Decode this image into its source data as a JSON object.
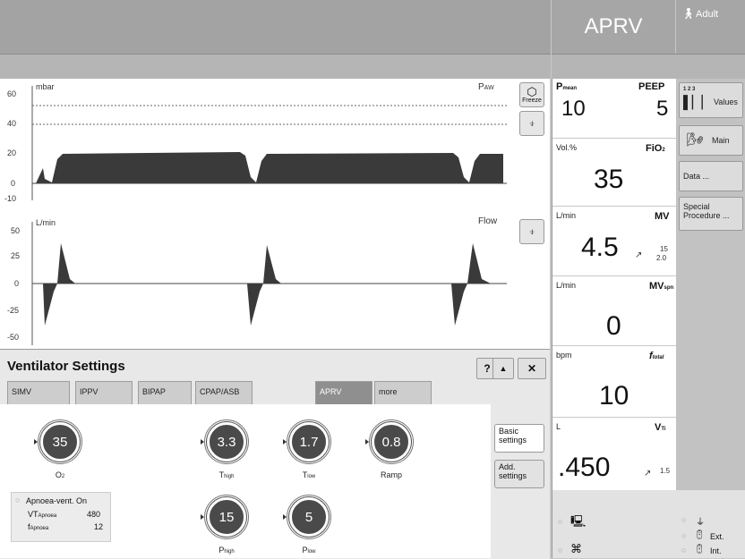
{
  "header": {
    "mode": "APRV",
    "patient_type": "Adult"
  },
  "graph": {
    "paw": {
      "unit": "mbar",
      "name": "Pₐw",
      "name_main": "P",
      "name_sub": "AW",
      "ticks": [
        "60",
        "40",
        "20",
        "0",
        "-10"
      ]
    },
    "flow": {
      "unit": "L/min",
      "name": "Flow",
      "ticks": [
        "50",
        "25",
        "0",
        "-25",
        "-50"
      ]
    },
    "freeze_label": "Freeze"
  },
  "measurements": {
    "pmean": {
      "name": "P",
      "sub": "mean",
      "value": "10"
    },
    "peep": {
      "name": "PEEP",
      "value": "5"
    },
    "fio2": {
      "unit": "Vol.%",
      "name": "FiO",
      "sub": "2",
      "value": "35"
    },
    "mv": {
      "unit": "L/min",
      "name": "MV",
      "value": "4.5",
      "alarm_high": "15",
      "alarm_low": "2.0",
      "trend": "↗"
    },
    "mvspn": {
      "unit": "L/min",
      "name": "MV",
      "sub": "spn",
      "value": "0"
    },
    "ftotal": {
      "unit": "bpm",
      "name": "f",
      "sub": "total",
      "value": "10"
    },
    "vti": {
      "unit": "L",
      "name": "V",
      "sub": "Ti",
      "value": ".450",
      "alarm": "1.5",
      "trend": "↗"
    }
  },
  "right_menu": {
    "values": {
      "digits": "1 2 3",
      "label": "Values"
    },
    "main": "Main",
    "data": "Data ...",
    "special": "Special Procedure ..."
  },
  "footer_icons": {
    "ext": "Ext.",
    "int": "Int."
  },
  "settings": {
    "title": "Ventilator Settings",
    "help": "?",
    "up": "▲",
    "close": "✕",
    "tabs": [
      "SIMV",
      "IPPV",
      "BIPAP",
      "CPAP/ASB",
      "APRV",
      "more"
    ],
    "active_tab": "APRV",
    "basic": "Basic settings",
    "additional": "Add. settings",
    "knobs": [
      {
        "label": "O₂",
        "value": "35"
      },
      {
        "label": "Tₕᵢgh",
        "value": "3.3"
      },
      {
        "label": "Tₗow",
        "value": "1.7"
      },
      {
        "label": "Ramp",
        "value": "0.8"
      },
      {
        "label": "Pₕᵢgh",
        "value": "15"
      },
      {
        "label": "Pₗow",
        "value": "5"
      }
    ],
    "knob_labels": {
      "o2": "O",
      "o2_sub": "2",
      "thigh": "T",
      "thigh_sub": "high",
      "tlow": "T",
      "tlow_sub": "low",
      "phigh": "P",
      "phigh_sub": "high",
      "plow": "P",
      "plow_sub": "low",
      "ramp": "Ramp"
    },
    "apnoea": {
      "title": "Apnoea-vent. On",
      "vt_label": "VT",
      "vt_sub": "Apnoea",
      "vt_value": "480",
      "f_label": "f",
      "f_sub": "Apnoea",
      "f_value": "12"
    }
  }
}
